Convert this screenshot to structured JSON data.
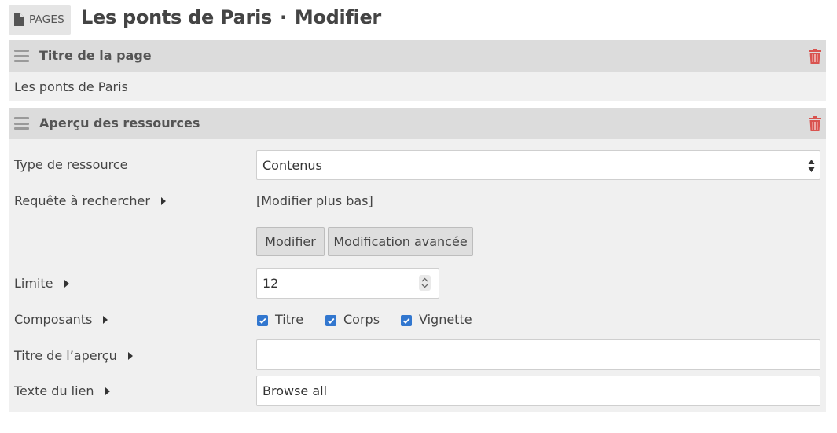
{
  "header": {
    "pages_label": "PAGES",
    "page_title": "Les ponts de Paris",
    "separator": "·",
    "mode": "Modifier"
  },
  "block1": {
    "title": "Titre de la page",
    "value": "Les ponts de Paris"
  },
  "block2": {
    "title": "Aperçu des ressources",
    "resource_type_label": "Type de ressource",
    "resource_type_value": "Contenus",
    "query_label": "Requête à rechercher",
    "query_value": "[Modifier plus bas]",
    "edit_button": "Modifier",
    "advanced_button": "Modification avancée",
    "limit_label": "Limite",
    "limit_value": "12",
    "components_label": "Composants",
    "components": [
      {
        "label": "Titre",
        "checked": true
      },
      {
        "label": "Corps",
        "checked": true
      },
      {
        "label": "Vignette",
        "checked": true
      }
    ],
    "preview_title_label": "Titre de l’aperçu",
    "preview_title_value": "",
    "link_text_label": "Texte du lien",
    "link_text_value": "Browse all"
  },
  "colors": {
    "accent": "#3277cf",
    "trash": "#d9534f",
    "header_bg": "#dcdcdc",
    "body_bg": "#f0f0f0"
  }
}
